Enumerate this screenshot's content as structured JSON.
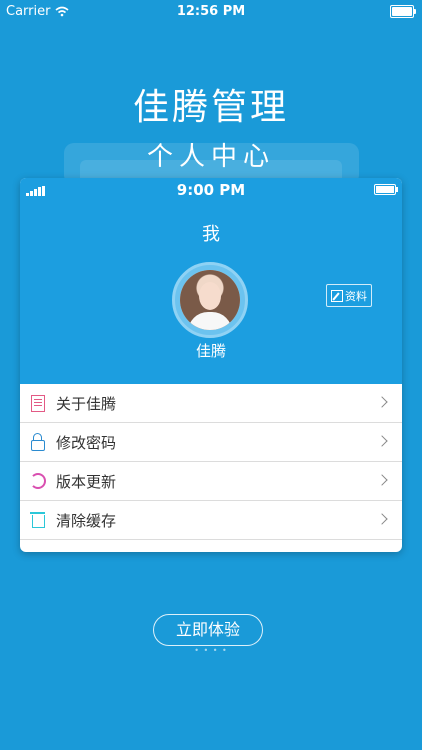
{
  "statusbar": {
    "carrier": "Carrier",
    "time": "12:56 PM"
  },
  "app_title": "佳腾管理",
  "subtitle": "个人中心",
  "phone": {
    "time": "9:00 PM",
    "header": "我",
    "username": "佳腾",
    "profile_button": "资料",
    "menu": [
      {
        "label": "关于佳腾",
        "icon": "document-icon"
      },
      {
        "label": "修改密码",
        "icon": "lock-icon"
      },
      {
        "label": "版本更新",
        "icon": "refresh-icon"
      },
      {
        "label": "清除缓存",
        "icon": "trash-icon"
      }
    ]
  },
  "cta_label": "立即体验",
  "colors": {
    "background": "#1a9ad8",
    "phone_header": "#1c9ee0"
  }
}
